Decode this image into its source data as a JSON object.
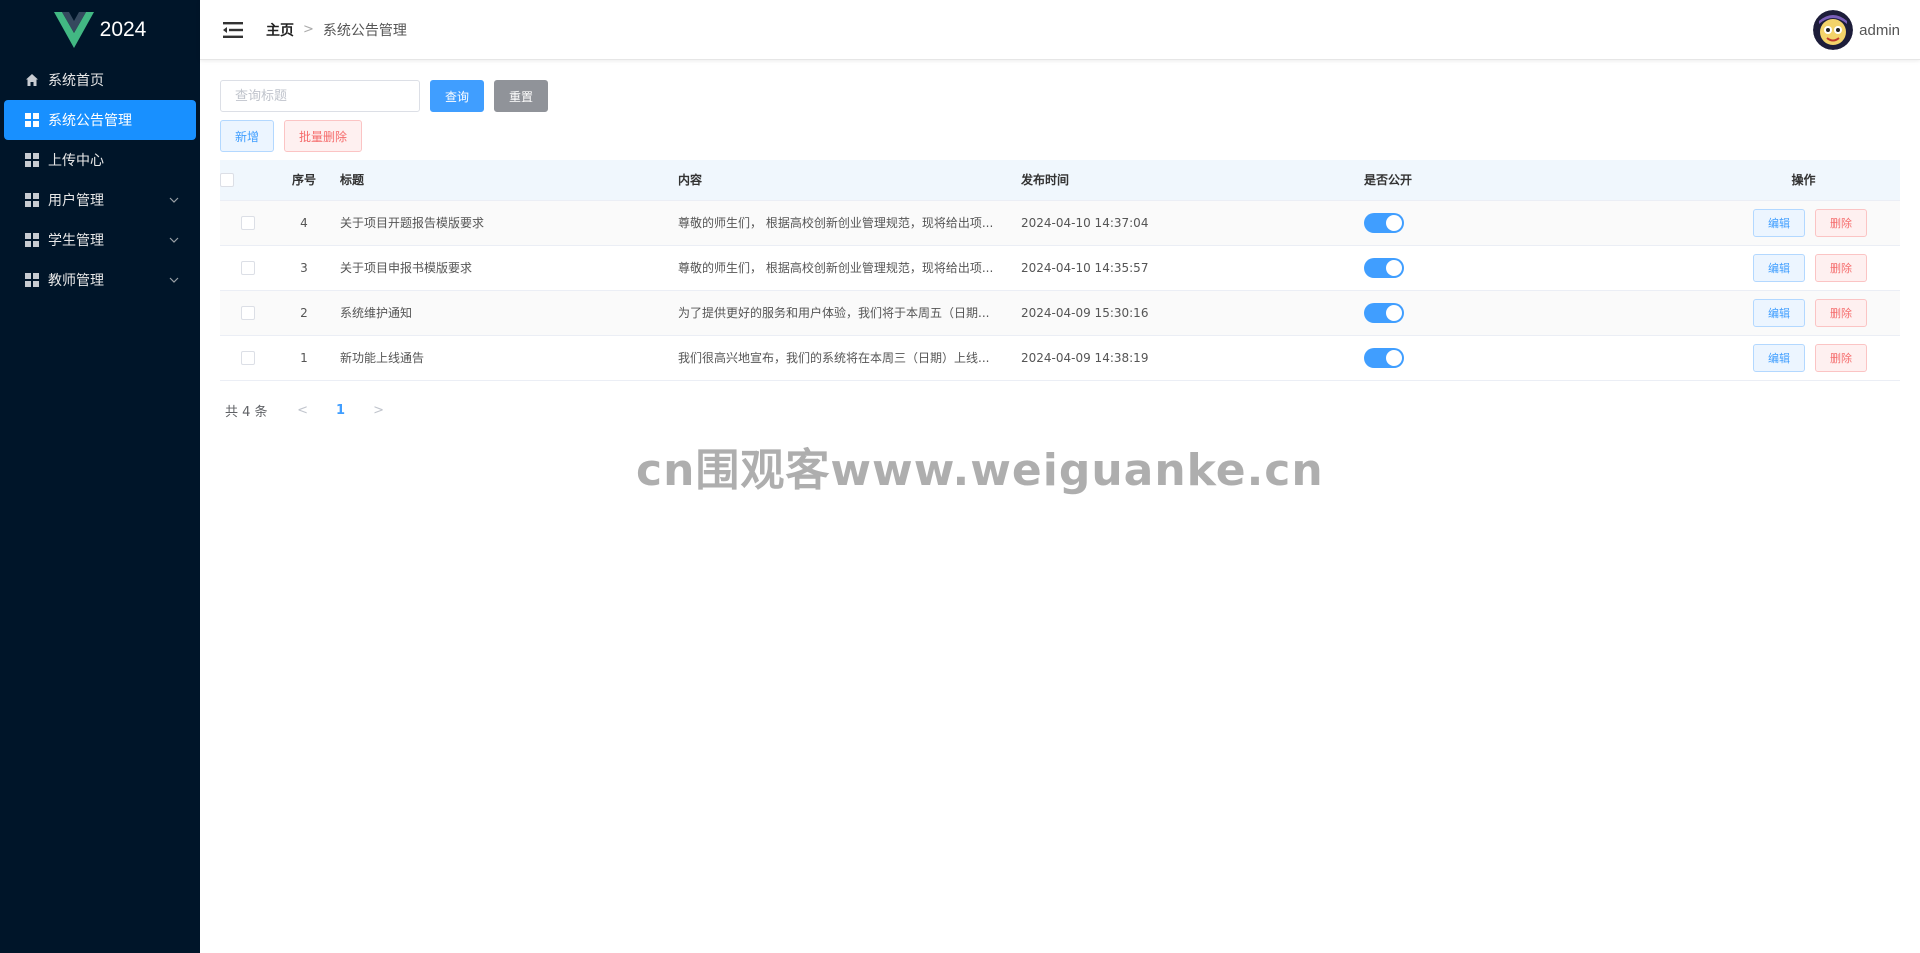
{
  "logo": {
    "text": "2024"
  },
  "sidebar": {
    "items": [
      {
        "label": "系统首页",
        "icon": "home-icon"
      },
      {
        "label": "系统公告管理",
        "icon": "grid-icon",
        "active": true
      },
      {
        "label": "上传中心",
        "icon": "grid-icon"
      },
      {
        "label": "用户管理",
        "icon": "grid-icon",
        "expandable": true
      },
      {
        "label": "学生管理",
        "icon": "grid-icon",
        "expandable": true
      },
      {
        "label": "教师管理",
        "icon": "grid-icon",
        "expandable": true
      }
    ]
  },
  "header": {
    "breadcrumb_home": "主页",
    "breadcrumb_sep": ">",
    "breadcrumb_current": "系统公告管理",
    "username": "admin"
  },
  "search": {
    "placeholder": "查询标题",
    "query_label": "查询",
    "reset_label": "重置"
  },
  "actions": {
    "add_label": "新增",
    "batch_delete_label": "批量删除"
  },
  "table": {
    "headers": {
      "no": "序号",
      "title": "标题",
      "content": "内容",
      "time": "发布时间",
      "public": "是否公开",
      "ops": "操作"
    },
    "rows": [
      {
        "no": "4",
        "title": "关于项目开题报告模版要求",
        "content": "尊敬的师生们， 根据高校创新创业管理规范，现将给出项...",
        "time": "2024-04-10 14:37:04",
        "public": true
      },
      {
        "no": "3",
        "title": "关于项目申报书模版要求",
        "content": "尊敬的师生们， 根据高校创新创业管理规范，现将给出项...",
        "time": "2024-04-10 14:35:57",
        "public": true
      },
      {
        "no": "2",
        "title": "系统维护通知",
        "content": "为了提供更好的服务和用户体验，我们将于本周五（日期...",
        "time": "2024-04-09 15:30:16",
        "public": true
      },
      {
        "no": "1",
        "title": "新功能上线通告",
        "content": "我们很高兴地宣布，我们的系统将在本周三（日期）上线...",
        "time": "2024-04-09 14:38:19",
        "public": true
      }
    ],
    "edit_label": "编辑",
    "delete_label": "删除"
  },
  "pagination": {
    "total": "共 4 条",
    "current": "1",
    "prev": "<",
    "next": ">"
  },
  "watermark": "cn围观客www.weiguanke.cn",
  "colors": {
    "sidebar_bg": "#001529",
    "accent": "#1890ff",
    "primary": "#409eff",
    "danger": "#f56c6c"
  }
}
